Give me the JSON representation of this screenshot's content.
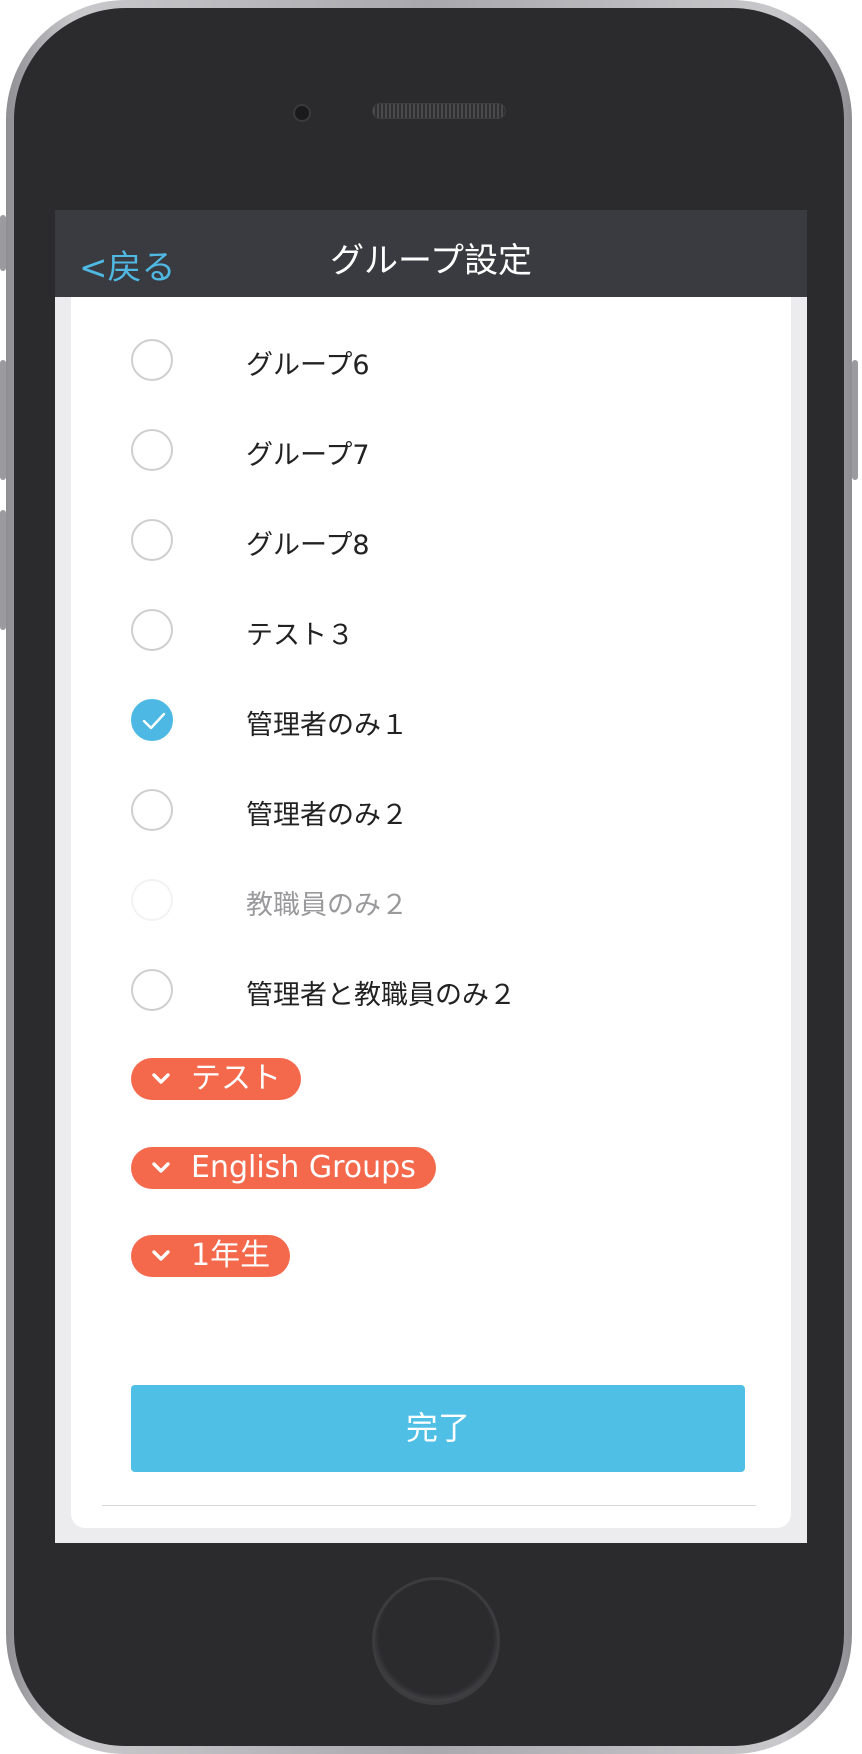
{
  "nav": {
    "back_label": "<戻る",
    "title": "グループ設定"
  },
  "groups": [
    {
      "label": "グループ6",
      "state": "unchecked"
    },
    {
      "label": "グループ7",
      "state": "unchecked"
    },
    {
      "label": "グループ8",
      "state": "unchecked"
    },
    {
      "label": "テスト３",
      "state": "unchecked"
    },
    {
      "label": "管理者のみ１",
      "state": "checked"
    },
    {
      "label": "管理者のみ２",
      "state": "unchecked"
    },
    {
      "label": "教職員のみ２",
      "state": "disabled"
    },
    {
      "label": "管理者と教職員のみ２",
      "state": "unchecked"
    }
  ],
  "categories": [
    {
      "label": "テスト"
    },
    {
      "label": "English Groups"
    },
    {
      "label": "1年生"
    }
  ],
  "done_label": "完了",
  "colors": {
    "accent_blue": "#4fbfe6",
    "tag_orange": "#f4684c",
    "navbar": "#3a3b40"
  },
  "icons": {
    "checkmark": "check-icon",
    "chevron": "chevron-down-icon"
  }
}
